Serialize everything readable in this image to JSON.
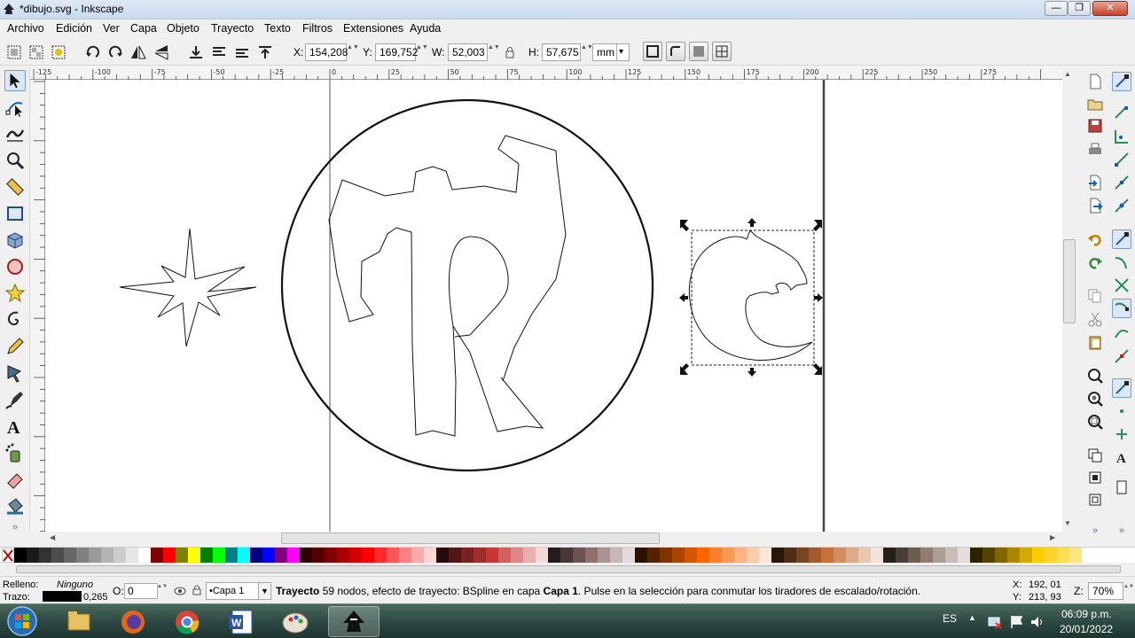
{
  "window": {
    "title": "*dibujo.svg - Inkscape",
    "minimize": "—",
    "maximize": "❐",
    "close": "✕"
  },
  "menu": [
    "Archivo",
    "Edición",
    "Ver",
    "Capa",
    "Objeto",
    "Trayecto",
    "Texto",
    "Filtros",
    "Extensiones",
    "Ayuda"
  ],
  "toolbar": {
    "x_label": "X:",
    "x_value": "154,208",
    "y_label": "Y:",
    "y_value": "169,752",
    "w_label": "W:",
    "w_value": "52,003",
    "h_label": "H:",
    "h_value": "57,675",
    "unit": "mm",
    "arrows": "▲▼",
    "dropdown": "▾"
  },
  "ruler_labels": [
    "-125",
    "-100",
    "-75",
    "-50",
    "-25",
    "0",
    "25",
    "50",
    "75",
    "100",
    "125",
    "150",
    "175",
    "200",
    "225",
    "250",
    "275"
  ],
  "status": {
    "fill_label": "Relleno:",
    "fill_value": "Ninguno",
    "stroke_label": "Trazo:",
    "stroke_width": "0,265",
    "opacity_label": "O:",
    "opacity_value": "0",
    "layer": "•Capa 1",
    "message_bold": "Trayecto",
    "message_text": " 59 nodos, efecto de trayecto: BSpline en capa ",
    "message_layer": "Capa 1",
    "message_tail": ". Pulse en la selección para conmutar los tiradores de escalado/rotación.",
    "cursor_x_label": "X:",
    "cursor_x": "192, 01",
    "cursor_y_label": "Y:",
    "cursor_y": "213, 93",
    "zoom_label": "Z:",
    "zoom": "70%"
  },
  "taskbar": {
    "lang": "ES",
    "time": "06:09 p.m.",
    "date": "20/01/2022"
  },
  "palette": [
    "#000000",
    "#1a1a1a",
    "#333333",
    "#4d4d4d",
    "#666666",
    "#808080",
    "#999999",
    "#b3b3b3",
    "#cccccc",
    "#e6e6e6",
    "#ffffff",
    "#800000",
    "#ff0000",
    "#808000",
    "#ffff00",
    "#008000",
    "#00ff00",
    "#008080",
    "#00ffff",
    "#000080",
    "#0000ff",
    "#800080",
    "#ff00ff",
    "#2b0000",
    "#550000",
    "#800000",
    "#aa0000",
    "#d40000",
    "#ff0000",
    "#ff2a2a",
    "#ff5555",
    "#ff8080",
    "#ffaaaa",
    "#ffd5d5",
    "#280b0b",
    "#501616",
    "#782121",
    "#a02c2c",
    "#c83737",
    "#d35f5f",
    "#de8787",
    "#e9afaf",
    "#f4d7d7",
    "#241c1c",
    "#483737",
    "#6c5353",
    "#916f6f",
    "#ac9393",
    "#c8b7b7",
    "#e3dbdb",
    "#2b1100",
    "#552200",
    "#803300",
    "#aa4400",
    "#d45500",
    "#ff6600",
    "#ff7f2a",
    "#ff9955",
    "#ffb380",
    "#ffccaa",
    "#ffe6d5",
    "#28170b",
    "#502d16",
    "#784421",
    "#a05a2c",
    "#c87137",
    "#d38d5f",
    "#deaa87",
    "#e9c6af",
    "#f4e3d7",
    "#241f1c",
    "#483e37",
    "#6c5d53",
    "#917c6f",
    "#ac9d93",
    "#c8beb7",
    "#e3dedb",
    "#2b2200",
    "#554400",
    "#806600",
    "#aa8800",
    "#d4aa00",
    "#ffcc00",
    "#ffd42a",
    "#ffdd55",
    "#ffe680"
  ]
}
